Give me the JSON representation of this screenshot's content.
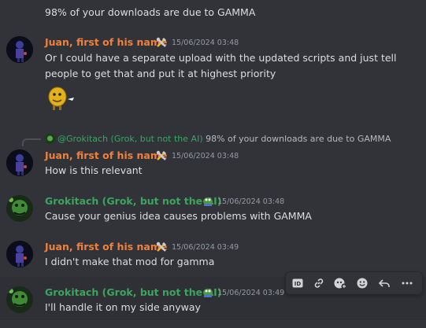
{
  "top_message": "98% of your downloads are due to GAMMA",
  "messages": [
    {
      "author": "Juan, first of his name",
      "timestamp": "15/06/2024 03:48",
      "lines": [
        "Or I could have a separate upload with the updated scripts and just tell",
        "people to get that and put it at highest priority"
      ],
      "attachment": "emoji-sticker"
    },
    {
      "reply_author": "@Grokitach (Grok, but not the AI)",
      "reply_text": "98% of your downloads are due to GAMMA",
      "author": "Juan, first of his name",
      "timestamp": "15/06/2024 03:48",
      "text": "How is this relevant"
    },
    {
      "author": "Grokitach (Grok, but not the AI)",
      "timestamp": "15/06/2024 03:48",
      "text": "Cause your genius idea causes problems with GAMMA"
    },
    {
      "author": "Juan, first of his name",
      "timestamp": "15/06/2024 03:49",
      "text": "I didn't make that mod for gamma"
    },
    {
      "author": "Grokitach (Grok, but not the AI)",
      "timestamp": "15/06/2024 03:49",
      "text": "I'll handle it on my side anyway"
    }
  ],
  "colors": {
    "background": "#313338",
    "juan_name": "#f0803c",
    "grok_name": "#3ba55d",
    "timestamp": "#949ba4",
    "text": "#dbdee1"
  },
  "toolbar": {
    "buttons": [
      "id-icon",
      "link-icon",
      "react-pepe-icon",
      "add-reaction-icon",
      "reply-icon",
      "more-icon"
    ]
  }
}
